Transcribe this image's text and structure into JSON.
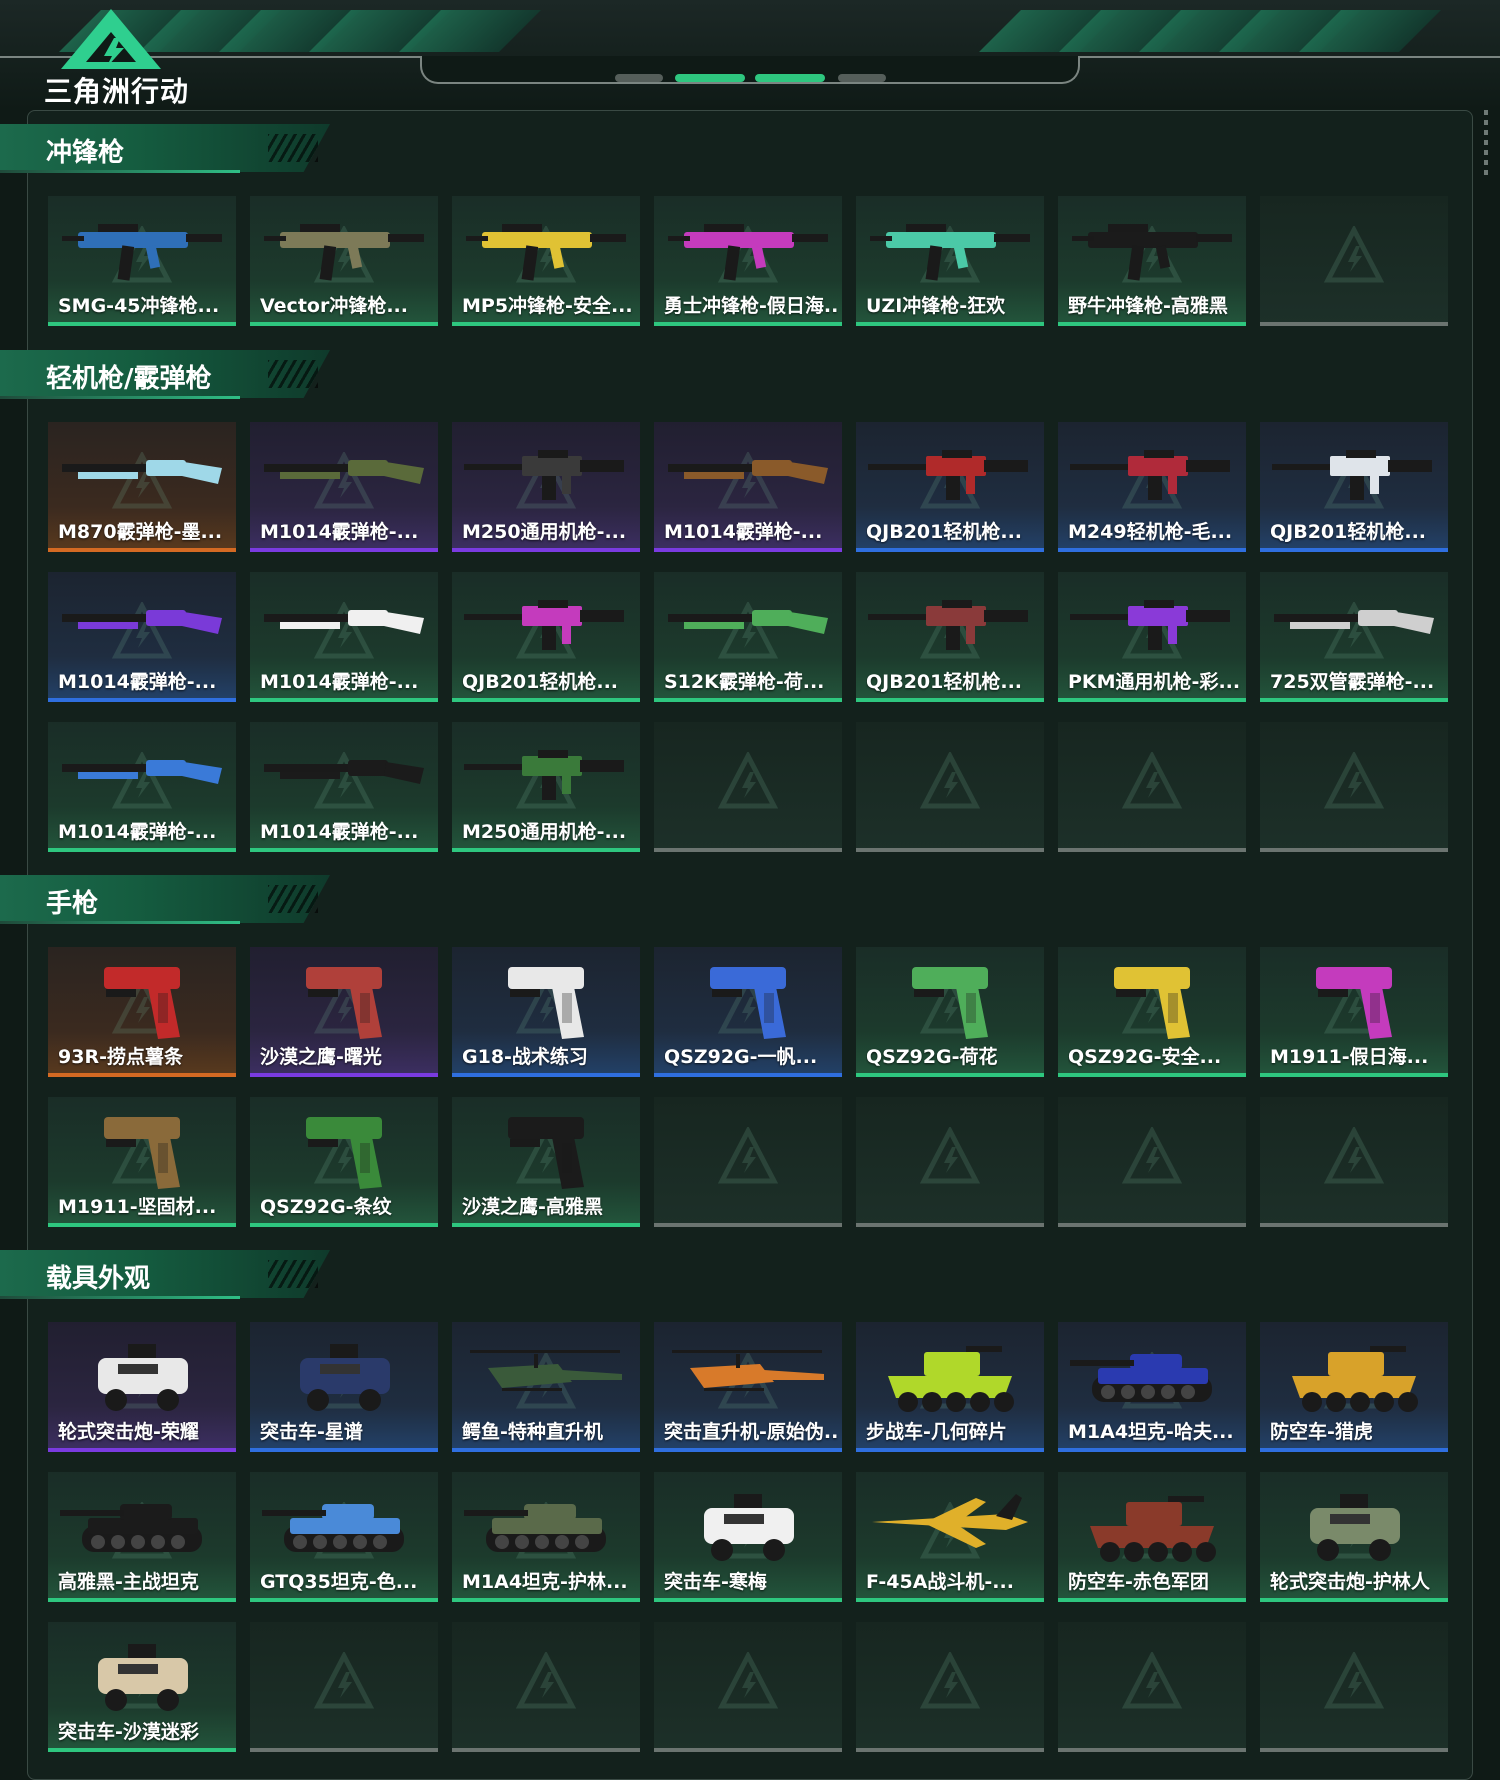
{
  "app": {
    "logo_text": "三角洲行动"
  },
  "sections": [
    {
      "title": "冲锋枪",
      "items": [
        {
          "name": "SMG-45冲锋枪...",
          "rarity": "green",
          "icon": "smg-icon",
          "tint": "#2f6fb8"
        },
        {
          "name": "Vector冲锋枪...",
          "rarity": "green",
          "icon": "smg-icon",
          "tint": "#7d7a58"
        },
        {
          "name": "MP5冲锋枪-安全...",
          "rarity": "green",
          "icon": "smg-icon",
          "tint": "#e0c234"
        },
        {
          "name": "勇士冲锋枪-假日海...",
          "rarity": "green",
          "icon": "smg-icon",
          "tint": "#c43bbd"
        },
        {
          "name": "UZI冲锋枪-狂欢",
          "rarity": "green",
          "icon": "smg-icon",
          "tint": "#4bc9a7"
        },
        {
          "name": "野牛冲锋枪-高雅黑",
          "rarity": "green",
          "icon": "smg-icon",
          "tint": "#1b1b1b"
        },
        {
          "name": "",
          "rarity": "empty"
        }
      ]
    },
    {
      "title": "轻机枪/霰弹枪",
      "items": [
        {
          "name": "M870霰弹枪-墨...",
          "rarity": "gold",
          "icon": "shotgun-icon",
          "tint": "#9fd8e8"
        },
        {
          "name": "M1014霰弹枪-...",
          "rarity": "purple",
          "icon": "shotgun-icon",
          "tint": "#5a6a3a"
        },
        {
          "name": "M250通用机枪-...",
          "rarity": "purple",
          "icon": "machinegun-icon",
          "tint": "#3a3a3a"
        },
        {
          "name": "M1014霰弹枪-...",
          "rarity": "purple",
          "icon": "shotgun-icon",
          "tint": "#8a5a2a"
        },
        {
          "name": "QJB201轻机枪...",
          "rarity": "blue",
          "icon": "machinegun-icon",
          "tint": "#b02a2a"
        },
        {
          "name": "M249轻机枪-毛...",
          "rarity": "blue",
          "icon": "machinegun-icon",
          "tint": "#b02a3a"
        },
        {
          "name": "QJB201轻机枪...",
          "rarity": "blue",
          "icon": "machinegun-icon",
          "tint": "#dfe4ea"
        },
        {
          "name": "M1014霰弹枪-...",
          "rarity": "blue",
          "icon": "shotgun-icon",
          "tint": "#7a3ad8"
        },
        {
          "name": "M1014霰弹枪-...",
          "rarity": "green",
          "icon": "shotgun-icon",
          "tint": "#f0f0f0"
        },
        {
          "name": "QJB201轻机枪...",
          "rarity": "green",
          "icon": "machinegun-icon",
          "tint": "#c43bbd"
        },
        {
          "name": "S12K霰弹枪-荷...",
          "rarity": "green",
          "icon": "shotgun-icon",
          "tint": "#4fae5a"
        },
        {
          "name": "QJB201轻机枪...",
          "rarity": "green",
          "icon": "machinegun-icon",
          "tint": "#8a3a3a"
        },
        {
          "name": "PKM通用机枪-彩...",
          "rarity": "green",
          "icon": "machinegun-icon",
          "tint": "#8a3ad8"
        },
        {
          "name": "725双管霰弹枪-...",
          "rarity": "green",
          "icon": "shotgun-icon",
          "tint": "#cfcfcf"
        },
        {
          "name": "M1014霰弹枪-...",
          "rarity": "green",
          "icon": "shotgun-icon",
          "tint": "#3a7ad8"
        },
        {
          "name": "M1014霰弹枪-...",
          "rarity": "green",
          "icon": "shotgun-icon",
          "tint": "#1b1b1b"
        },
        {
          "name": "M250通用机枪-...",
          "rarity": "green",
          "icon": "machinegun-icon",
          "tint": "#3a7a3a"
        },
        {
          "name": "",
          "rarity": "empty"
        },
        {
          "name": "",
          "rarity": "empty"
        },
        {
          "name": "",
          "rarity": "empty"
        },
        {
          "name": "",
          "rarity": "empty"
        }
      ]
    },
    {
      "title": "手枪",
      "items": [
        {
          "name": "93R-捞点薯条",
          "rarity": "gold",
          "icon": "pistol-icon",
          "tint": "#c22a2a"
        },
        {
          "name": "沙漠之鹰-曙光",
          "rarity": "purple",
          "icon": "pistol-icon",
          "tint": "#b0403a"
        },
        {
          "name": "G18-战术练习",
          "rarity": "blue",
          "icon": "pistol-icon",
          "tint": "#e8e8e8"
        },
        {
          "name": "QSZ92G-一帆...",
          "rarity": "blue",
          "icon": "pistol-icon",
          "tint": "#3a6ad8"
        },
        {
          "name": "QSZ92G-荷花",
          "rarity": "green",
          "icon": "pistol-icon",
          "tint": "#4fae5a"
        },
        {
          "name": "QSZ92G-安全...",
          "rarity": "green",
          "icon": "pistol-icon",
          "tint": "#e0c234"
        },
        {
          "name": "M1911-假日海...",
          "rarity": "green",
          "icon": "pistol-icon",
          "tint": "#c43bbd"
        },
        {
          "name": "M1911-坚固材...",
          "rarity": "green",
          "icon": "pistol-icon",
          "tint": "#8a6a3a"
        },
        {
          "name": "QSZ92G-条纹",
          "rarity": "green",
          "icon": "pistol-icon",
          "tint": "#3a8a3a"
        },
        {
          "name": "沙漠之鹰-高雅黑",
          "rarity": "green",
          "icon": "pistol-icon",
          "tint": "#1b1b1b"
        },
        {
          "name": "",
          "rarity": "empty"
        },
        {
          "name": "",
          "rarity": "empty"
        },
        {
          "name": "",
          "rarity": "empty"
        },
        {
          "name": "",
          "rarity": "empty"
        }
      ]
    },
    {
      "title": "载具外观",
      "items": [
        {
          "name": "轮式突击炮-荣耀",
          "rarity": "purple",
          "icon": "armored-car-icon",
          "tint": "#e8e8e8"
        },
        {
          "name": "突击车-星谱",
          "rarity": "blue",
          "icon": "armored-car-icon",
          "tint": "#2a3a6a"
        },
        {
          "name": "鳄鱼-特种直升机",
          "rarity": "blue",
          "icon": "helicopter-icon",
          "tint": "#3a5a3a"
        },
        {
          "name": "突击直升机-原始伪...",
          "rarity": "blue",
          "icon": "helicopter-icon",
          "tint": "#d87a2a"
        },
        {
          "name": "步战车-几何碎片",
          "rarity": "blue",
          "icon": "ifv-icon",
          "tint": "#b0d82a"
        },
        {
          "name": "M1A4坦克-哈夫...",
          "rarity": "blue",
          "icon": "tank-icon",
          "tint": "#2a3ab0"
        },
        {
          "name": "防空车-猎虎",
          "rarity": "blue",
          "icon": "ifv-icon",
          "tint": "#d8a22a"
        },
        {
          "name": "高雅黑-主战坦克",
          "rarity": "green",
          "icon": "tank-icon",
          "tint": "#1b1b1b"
        },
        {
          "name": "GTQ35坦克-色...",
          "rarity": "green",
          "icon": "tank-icon",
          "tint": "#4a8ad8"
        },
        {
          "name": "M1A4坦克-护林...",
          "rarity": "green",
          "icon": "tank-icon",
          "tint": "#5a6a4a"
        },
        {
          "name": "突击车-寒梅",
          "rarity": "green",
          "icon": "armored-car-icon",
          "tint": "#f0f0f0"
        },
        {
          "name": "F-45A战斗机-...",
          "rarity": "green",
          "icon": "jet-icon",
          "tint": "#e0b02a"
        },
        {
          "name": "防空车-赤色军团",
          "rarity": "green",
          "icon": "ifv-icon",
          "tint": "#8a3a2a"
        },
        {
          "name": "轮式突击炮-护林人",
          "rarity": "green",
          "icon": "armored-car-icon",
          "tint": "#7a8a6a"
        },
        {
          "name": "突击车-沙漠迷彩",
          "rarity": "green",
          "icon": "armored-car-icon",
          "tint": "#d8c8a8"
        },
        {
          "name": "",
          "rarity": "empty"
        },
        {
          "name": "",
          "rarity": "empty"
        },
        {
          "name": "",
          "rarity": "empty"
        },
        {
          "name": "",
          "rarity": "empty"
        },
        {
          "name": "",
          "rarity": "empty"
        },
        {
          "name": "",
          "rarity": "empty"
        }
      ]
    }
  ]
}
